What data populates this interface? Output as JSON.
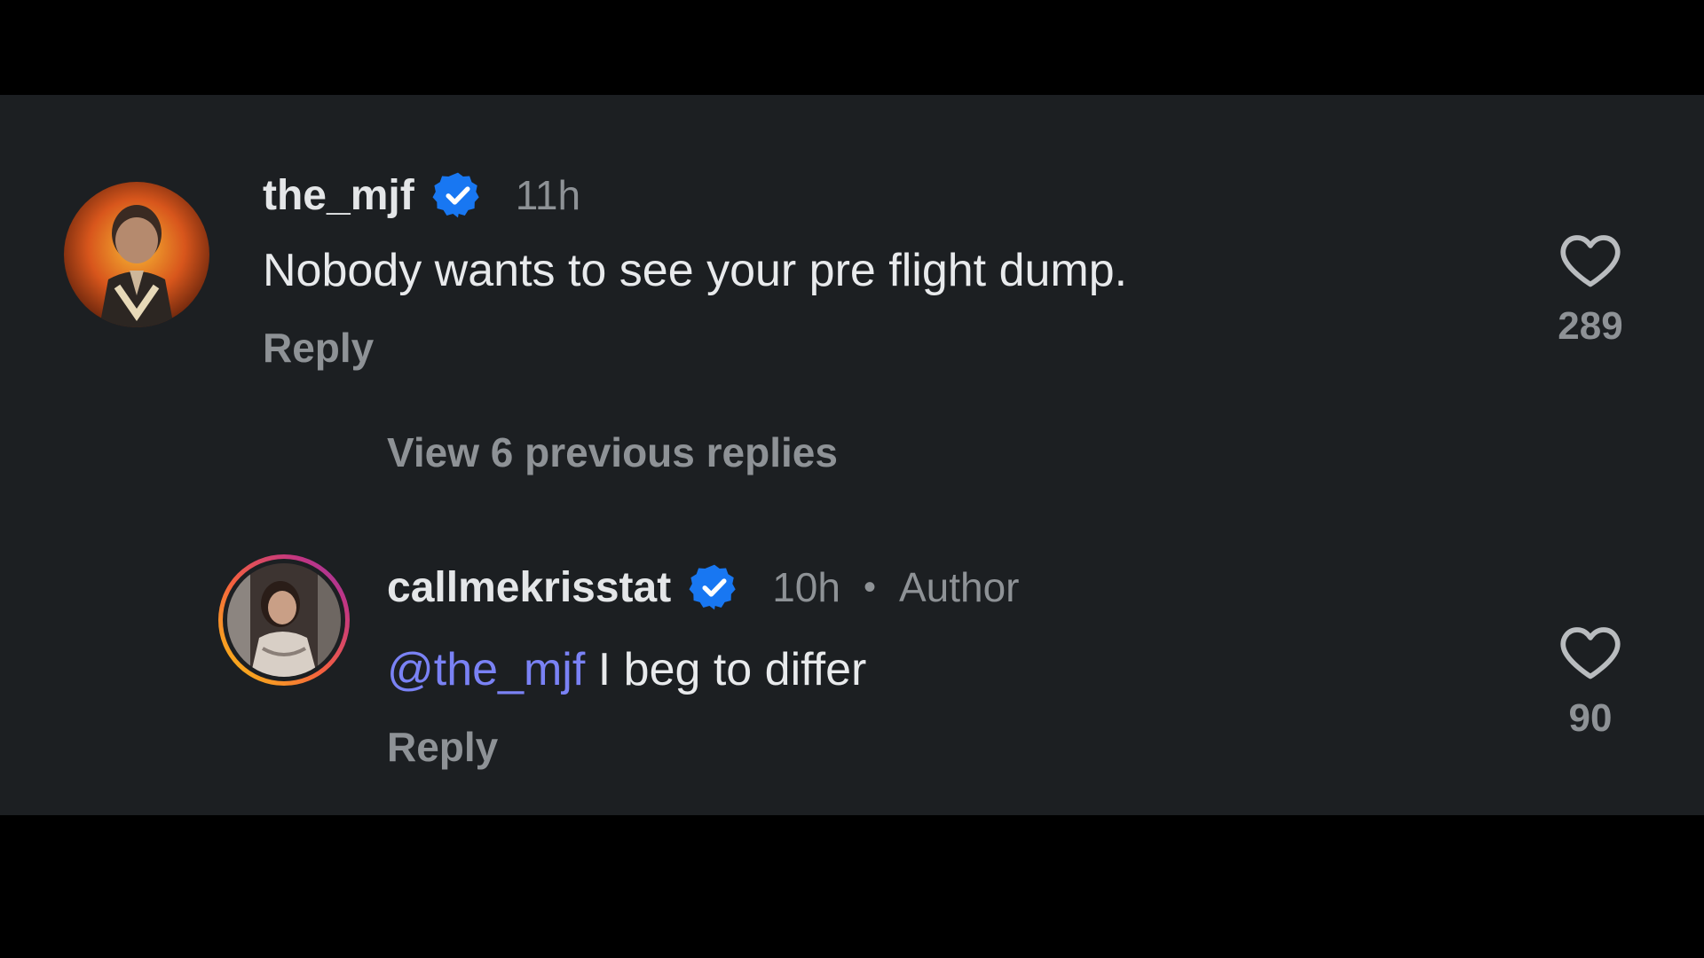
{
  "colors": {
    "background": "#000000",
    "panel": "#1c1f22",
    "text_primary": "#e8eaec",
    "text_secondary": "#8e9296",
    "verified_blue": "#1877f2",
    "mention": "#7a82f5"
  },
  "comments": [
    {
      "username": "the_mjf",
      "verified": true,
      "verified_icon": "verified-badge-icon",
      "time": "11h",
      "text": "Nobody wants to see your pre flight dump.",
      "reply_label": "Reply",
      "like_icon": "heart-outline-icon",
      "likes": "289"
    },
    {
      "username": "callmekrisstat",
      "verified": true,
      "verified_icon": "verified-badge-icon",
      "time": "10h",
      "separator": "•",
      "author_label": "Author",
      "mention": "@the_mjf",
      "text": " I beg to differ",
      "reply_label": "Reply",
      "like_icon": "heart-outline-icon",
      "likes": "90"
    }
  ],
  "view_replies_label": "View 6 previous replies"
}
